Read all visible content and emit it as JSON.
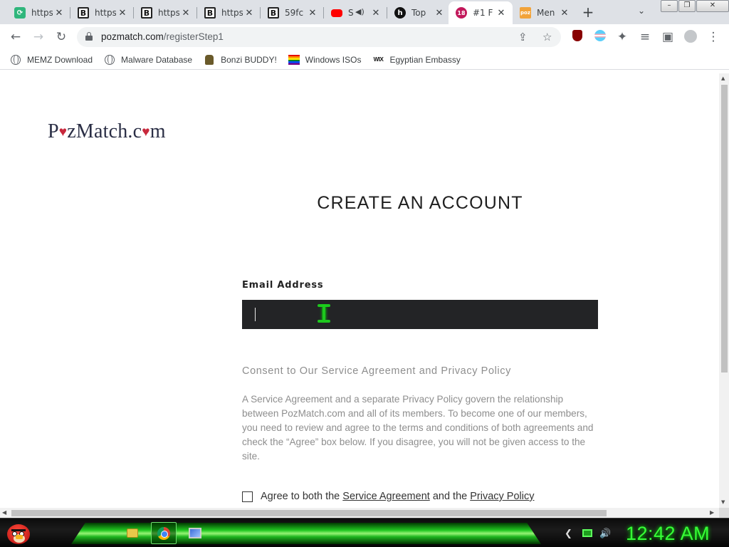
{
  "browser": {
    "tabs": [
      {
        "title": "https",
        "favicon": "green-square-icon"
      },
      {
        "title": "https",
        "favicon": "b-letter-icon"
      },
      {
        "title": "https",
        "favicon": "b-letter-icon"
      },
      {
        "title": "https",
        "favicon": "b-letter-icon"
      },
      {
        "title": "59fc",
        "favicon": "b-letter-icon"
      },
      {
        "title": "S",
        "favicon": "youtube-icon",
        "audio": true
      },
      {
        "title": "Top",
        "favicon": "h-circle-icon"
      },
      {
        "title": "#1 F",
        "favicon": "18-badge-icon",
        "active": true
      },
      {
        "title": "Men",
        "favicon": "poz-icon"
      }
    ],
    "url_domain": "pozmatch.com",
    "url_path": "/registerStep1",
    "bookmarks": [
      {
        "label": "MEMZ Download",
        "icon": "globe-icon"
      },
      {
        "label": "Malware Database",
        "icon": "globe-icon"
      },
      {
        "label": "Bonzi BUDDY!",
        "icon": "bonzi-icon"
      },
      {
        "label": "Windows ISOs",
        "icon": "rainbow-flag-icon"
      },
      {
        "label": "Egyptian Embassy",
        "icon": "wix-icon"
      }
    ],
    "wix_text": "WIX"
  },
  "page": {
    "logo_part1": "P",
    "logo_heart1": "♥",
    "logo_part2": "zMatch.c",
    "logo_heart2": "♥",
    "logo_part3": "m",
    "heading": "CREATE AN ACCOUNT",
    "email_label": "Email Address",
    "email_value": "",
    "consent_title": "Consent to Our Service Agreement and Privacy Policy",
    "consent_body": "A Service Agreement and a separate Privacy Policy govern the relationship between PozMatch.com and all of its members. To become one of our members, you need to review and agree to the terms and conditions of both agreements and check the “Agree” box below. If you disagree, you will not be given access to the site.",
    "agree_prefix": "Agree to both the ",
    "agree_link1": "Service Agreement",
    "agree_mid": " and the ",
    "agree_link2": "Privacy Policy",
    "agree_checked": false
  },
  "taskbar": {
    "clock": "12:42 AM"
  },
  "colors": {
    "logo": "#2a2e45",
    "heart": "#c8283c",
    "email_field_bg": "#232426",
    "clock": "#37ff37",
    "taskbar_accent": "#20d020"
  }
}
